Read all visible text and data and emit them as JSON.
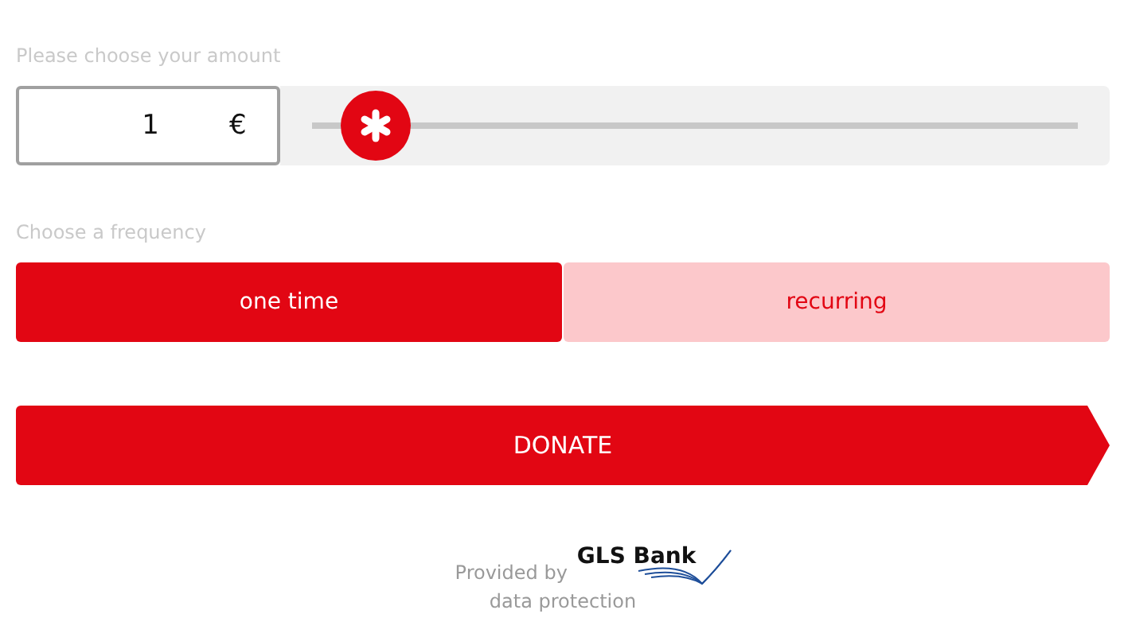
{
  "amount": {
    "label": "Please choose your amount",
    "value": "1",
    "currency": "€",
    "level": 0.02
  },
  "frequency": {
    "label": "Choose a frequency",
    "options": [
      {
        "label": "one time",
        "selected": true
      },
      {
        "label": "recurring",
        "selected": false
      }
    ]
  },
  "donate_button": "DONATE",
  "footer": {
    "provided_by": "Provided by",
    "bank": "GLS Bank",
    "link": "data protection"
  }
}
